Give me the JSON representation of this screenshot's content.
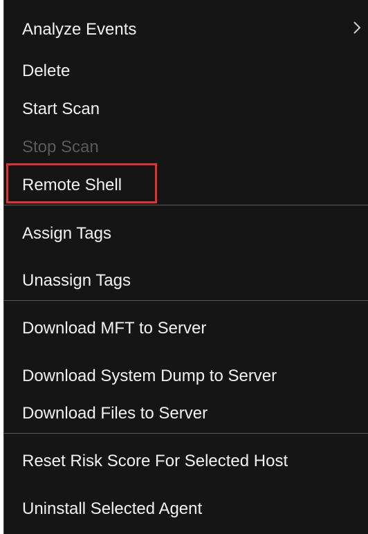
{
  "menu": {
    "items": [
      {
        "label": "Analyze Events",
        "has_submenu": true
      },
      {
        "label": "Delete"
      },
      {
        "label": "Start Scan"
      },
      {
        "label": "Stop Scan",
        "disabled": true
      },
      {
        "label": "Remote Shell",
        "highlighted": true
      },
      {
        "label": "Assign Tags"
      },
      {
        "label": "Unassign Tags"
      },
      {
        "label": "Download MFT to Server"
      },
      {
        "label": "Download System Dump to Server"
      },
      {
        "label": "Download Files to Server"
      },
      {
        "label": "Reset Risk Score For Selected Host"
      },
      {
        "label": "Uninstall Selected Agent"
      }
    ],
    "submenu_icon": "chevron-right-icon",
    "highlight_color": "#e0322f"
  }
}
